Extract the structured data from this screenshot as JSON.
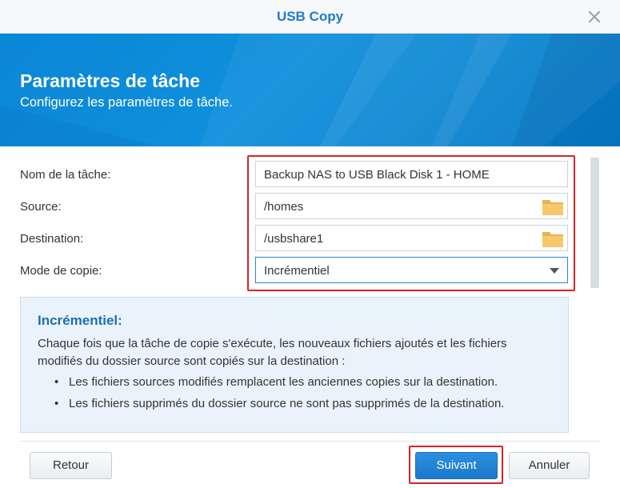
{
  "window": {
    "title": "USB Copy"
  },
  "banner": {
    "title": "Paramètres de tâche",
    "subtitle": "Configurez les paramètres de tâche."
  },
  "form": {
    "task_name": {
      "label": "Nom de la tâche:",
      "value": "Backup NAS to USB Black Disk 1 - HOME"
    },
    "source": {
      "label": "Source:",
      "value": "/homes"
    },
    "destination": {
      "label": "Destination:",
      "value": "/usbshare1"
    },
    "copy_mode": {
      "label": "Mode de copie:",
      "value": "Incrémentiel"
    }
  },
  "info": {
    "heading": "Incrémentiel:",
    "paragraph": "Chaque fois que la tâche de copie s'exécute, les nouveaux fichiers ajoutés et les fichiers modifiés du dossier source sont copiés sur la destination :",
    "bullets": [
      "Les fichiers sources modifiés remplacent les anciennes copies sur la destination.",
      "Les fichiers supprimés du dossier source ne sont pas supprimés de la destination."
    ]
  },
  "footer": {
    "back": "Retour",
    "next": "Suivant",
    "cancel": "Annuler"
  },
  "icons": {
    "close": "close-icon",
    "folder": "folder-icon",
    "dropdown": "chevron-down-icon"
  },
  "colors": {
    "accent": "#1c7bd0",
    "banner": "#0a86d6",
    "highlight": "#d9222a",
    "folder": "#f0c063"
  }
}
